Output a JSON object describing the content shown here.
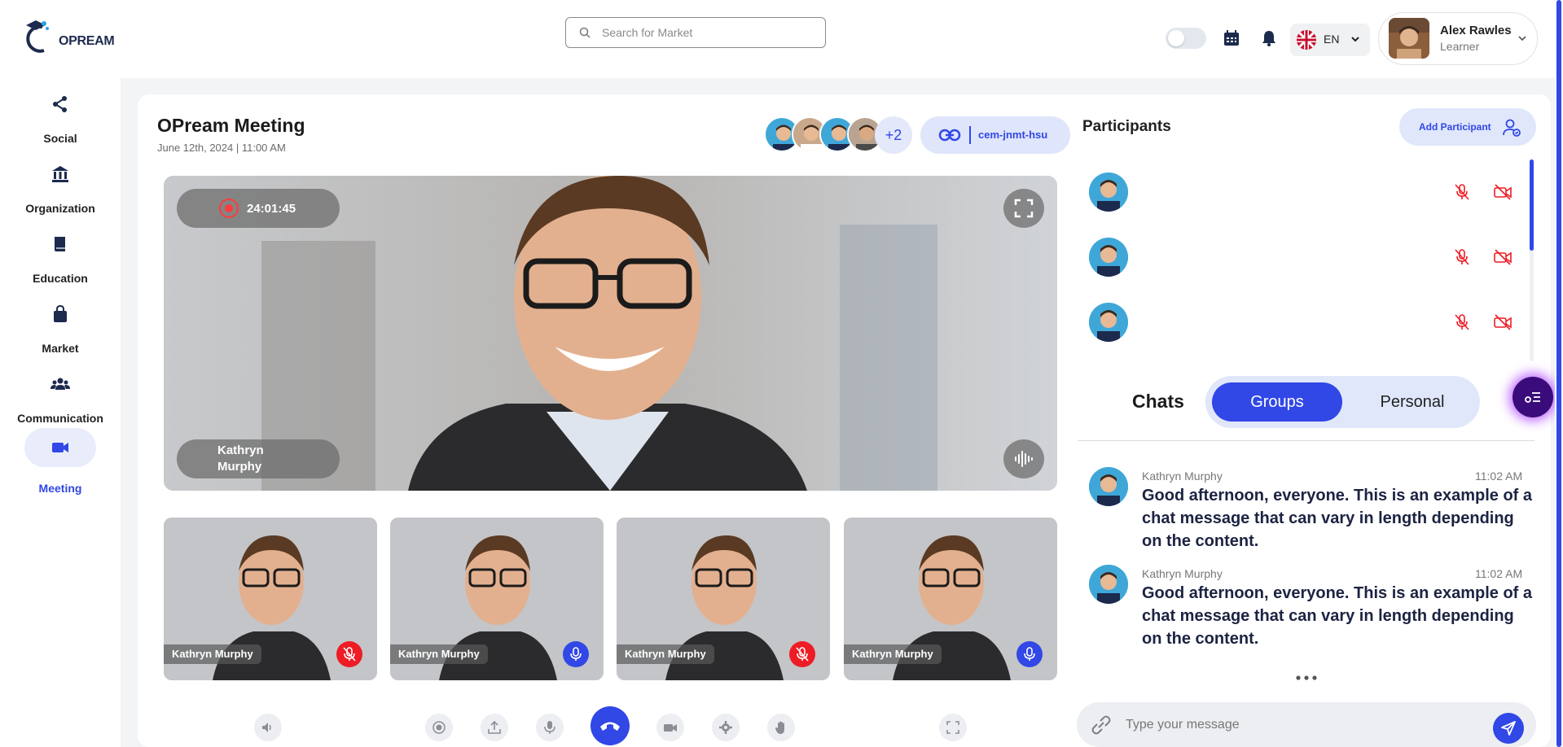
{
  "brand": {
    "logo_text": "OPREAM"
  },
  "header": {
    "search_placeholder": "Search for Market",
    "language": "EN",
    "user": {
      "name": "Alex Rawles",
      "role": "Learner"
    }
  },
  "sidebar": {
    "items": [
      {
        "label": "Social",
        "icon": "share-icon"
      },
      {
        "label": "Organization",
        "icon": "bank-icon"
      },
      {
        "label": "Education",
        "icon": "book-icon"
      },
      {
        "label": "Market",
        "icon": "shopping-bag-icon"
      },
      {
        "label": "Communication",
        "icon": "users-icon"
      },
      {
        "label": "Meeting",
        "icon": "video-camera-icon",
        "active": true
      }
    ]
  },
  "meeting": {
    "title": "OPream Meeting",
    "date": "June 12th, 2024 | 11:00 AM",
    "extra_count": "+2",
    "link_code": "cem-jnmt-hsu",
    "recording_time": "24:01:45",
    "speaker_name": "Kathryn Murphy",
    "thumbnails": [
      {
        "name": "Kathryn Murphy",
        "mic": "off"
      },
      {
        "name": "Kathryn Murphy",
        "mic": "on"
      },
      {
        "name": "Kathryn Murphy",
        "mic": "off"
      },
      {
        "name": "Kathryn Murphy",
        "mic": "on"
      }
    ]
  },
  "participants": {
    "title": "Participants",
    "add_label": "Add Participant"
  },
  "chats": {
    "title": "Chats",
    "tab_groups": "Groups",
    "tab_personal": "Personal",
    "messages": [
      {
        "name": "Kathryn Murphy",
        "time": "11:02 AM",
        "text": "Good afternoon, everyone. This is an example of a chat message that can vary in length depending on the content."
      },
      {
        "name": "Kathryn Murphy",
        "time": "11:02 AM",
        "text": "Good afternoon, everyone. This is an example of a chat message that can vary in length depending on the content."
      }
    ],
    "compose_placeholder": "Type your message"
  },
  "colors": {
    "accent": "#3147e6",
    "danger": "#ee1c24",
    "accent_soft": "#e0e7fb"
  }
}
